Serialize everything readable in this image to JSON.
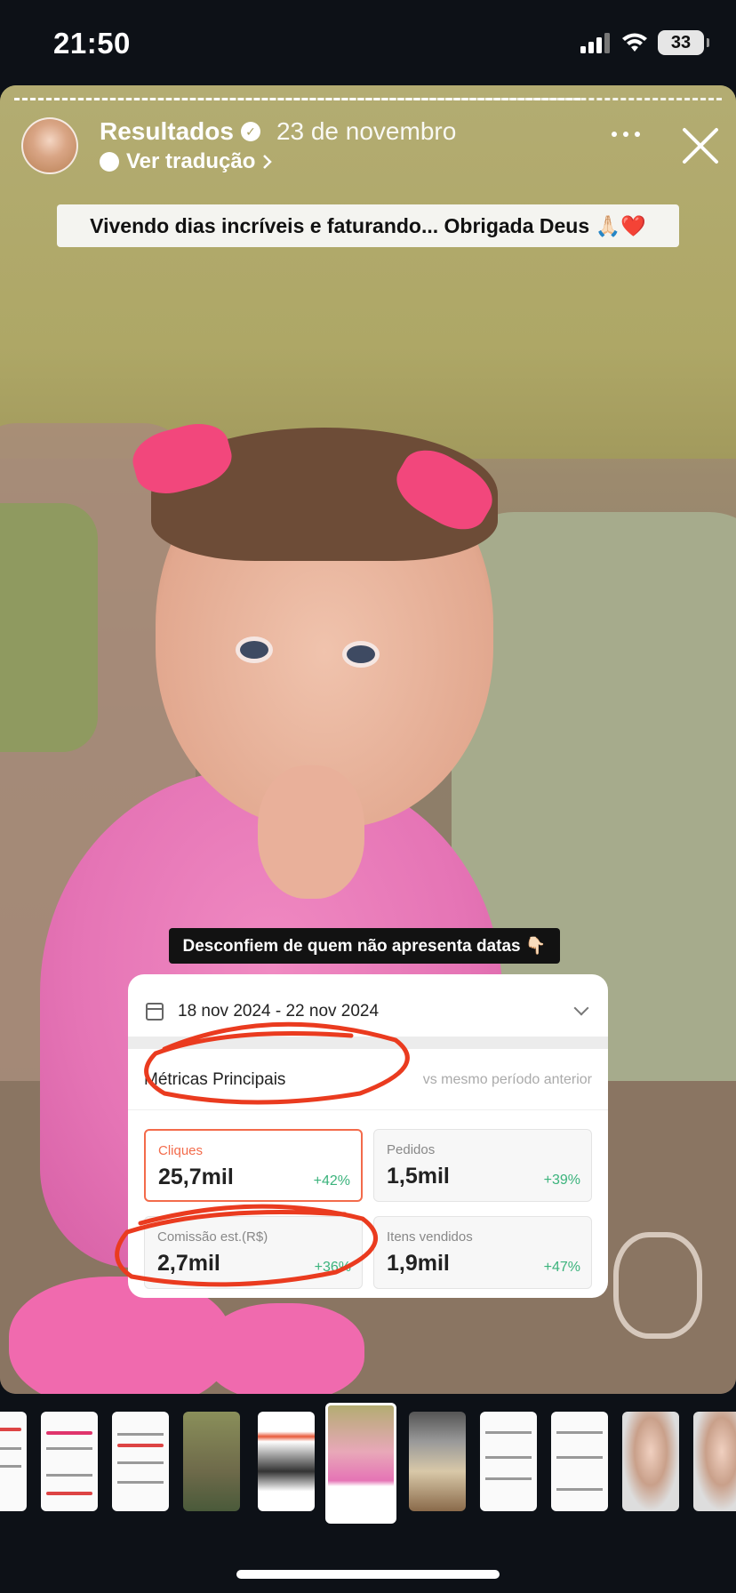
{
  "status_bar": {
    "time": "21:50",
    "battery": "33",
    "icons": [
      "signal-icon",
      "wifi-icon",
      "battery-icon"
    ]
  },
  "story": {
    "account_name": "Resultados",
    "date": "23 de novembro",
    "translate_label": "Ver tradução",
    "caption_top": "Vivendo dias incríveis e faturando... Obrigada Deus 🙏🏻❤️",
    "caption_mid": "Desconfiem de quem não apresenta datas 👇🏻",
    "progress_fraction": 0.8
  },
  "metrics_card": {
    "date_range": "18 nov 2024 - 22 nov 2024",
    "section_title": "Métricas Principais",
    "section_note": "vs mesmo período anterior",
    "metrics": [
      {
        "label": "Cliques",
        "value": "25,7mil",
        "change": "+42%"
      },
      {
        "label": "Pedidos",
        "value": "1,5mil",
        "change": "+39%"
      },
      {
        "label": "Comissão est.(R$)",
        "value": "2,7mil",
        "change": "+36%"
      },
      {
        "label": "Itens vendidos",
        "value": "1,9mil",
        "change": "+47%"
      }
    ]
  },
  "colors": {
    "accent": "#f36b4b",
    "positive": "#3bb37c",
    "background": "#0d1117"
  }
}
